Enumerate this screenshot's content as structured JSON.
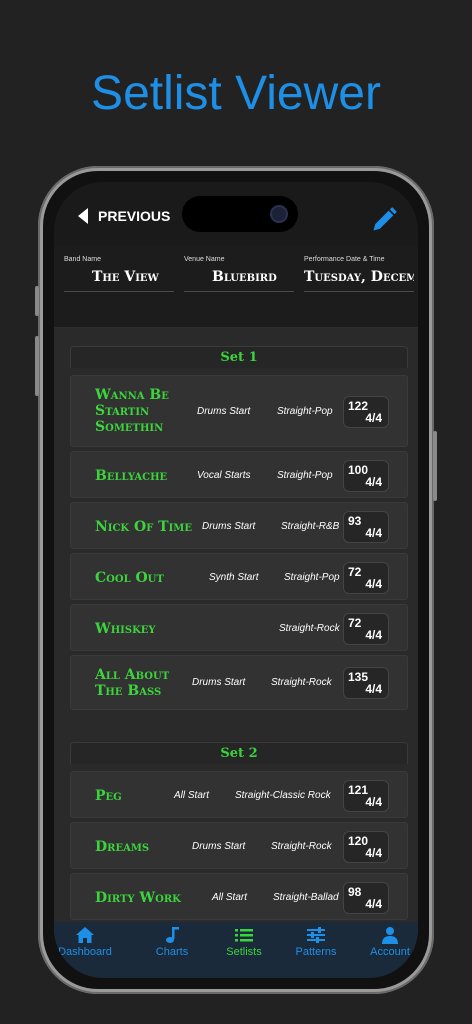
{
  "headline": "Setlist Viewer",
  "nav": {
    "back_label": "PREVIOUS"
  },
  "header": {
    "band": {
      "label": "Band Name",
      "value": "The View"
    },
    "venue": {
      "label": "Venue Name",
      "value": "Bluebird"
    },
    "date": {
      "label": "Performance Date & Time",
      "value": "Tuesday, Decembe"
    }
  },
  "sets": [
    {
      "title": "Set 1",
      "songs": [
        {
          "title": "Wanna Be Startin Somethin",
          "start": "Drums Start",
          "style": "Straight-Pop",
          "bpm": "122",
          "sig": "4/4"
        },
        {
          "title": "Bellyache",
          "start": "Vocal Starts",
          "style": "Straight-Pop",
          "bpm": "100",
          "sig": "4/4"
        },
        {
          "title": "Nick Of Time",
          "start": "Drums Start",
          "style": "Straight-R&B",
          "bpm": "93",
          "sig": "4/4"
        },
        {
          "title": "Cool Out",
          "start": "Synth Start",
          "style": "Straight-Pop",
          "bpm": "72",
          "sig": "4/4"
        },
        {
          "title": "Whiskey",
          "start": "",
          "style": "Straight-Rock",
          "bpm": "72",
          "sig": "4/4"
        },
        {
          "title": "All About The Bass",
          "start": "Drums Start",
          "style": "Straight-Rock",
          "bpm": "135",
          "sig": "4/4"
        }
      ]
    },
    {
      "title": "Set 2",
      "songs": [
        {
          "title": "Peg",
          "start": "All Start",
          "style": "Straight-Classic Rock",
          "bpm": "121",
          "sig": "4/4"
        },
        {
          "title": "Dreams",
          "start": "Drums Start",
          "style": "Straight-Rock",
          "bpm": "120",
          "sig": "4/4"
        },
        {
          "title": "Dirty Work",
          "start": "All Start",
          "style": "Straight-Ballad",
          "bpm": "98",
          "sig": "4/4"
        }
      ]
    }
  ],
  "tabs": [
    {
      "label": "Dashboard",
      "icon": "home-icon"
    },
    {
      "label": "Charts",
      "icon": "music-note-icon"
    },
    {
      "label": "Setlists",
      "icon": "list-icon"
    },
    {
      "label": "Patterns",
      "icon": "sliders-icon"
    },
    {
      "label": "Account",
      "icon": "person-icon"
    }
  ],
  "colors": {
    "accent_blue": "#1e8fe6",
    "accent_green": "#3cd43c"
  }
}
